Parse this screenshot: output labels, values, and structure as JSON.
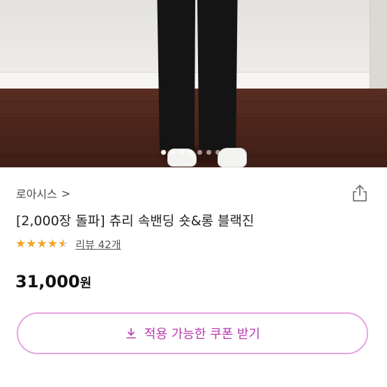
{
  "hero": {
    "pagination": {
      "count": 7,
      "active_index": 0
    }
  },
  "product": {
    "store_name": "로아시스",
    "store_chevron": ">",
    "title": "[2,000장 돌파] 츄리 속밴딩 숏&롱 블랙진",
    "rating": 4.5,
    "review_text": "리뷰 42개",
    "price_number": "31,000",
    "price_unit": "원"
  },
  "coupon_button": {
    "label": "적용 가능한 쿠폰 받기",
    "icon": "download-icon"
  },
  "colors": {
    "accent": "#b93ab0",
    "accent_border": "#e8a4e3",
    "star": "#f2a427"
  }
}
